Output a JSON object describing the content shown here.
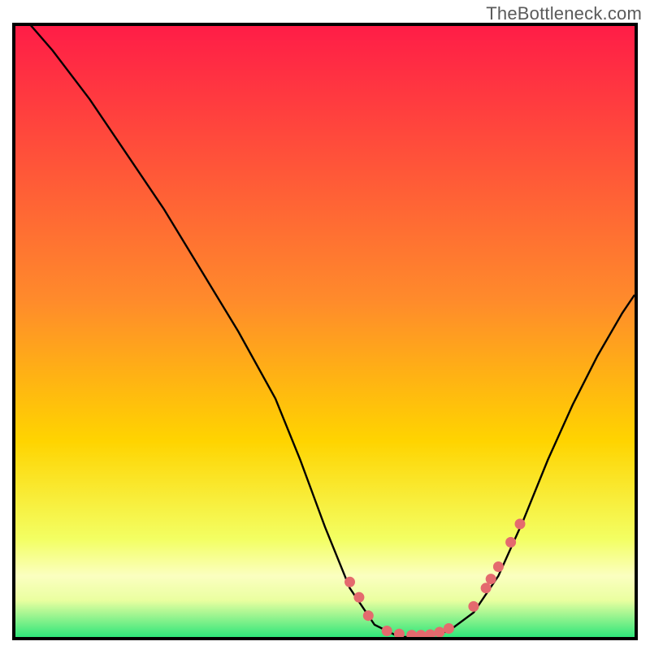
{
  "attribution": "TheBottleneck.com",
  "colors": {
    "gradient_top": "#ff1d47",
    "gradient_mid": "#ffd400",
    "gradient_low": "#f3ff63",
    "gradient_paleband": "#fbffc0",
    "gradient_bottom": "#2fe67a",
    "curve": "#000000",
    "points": "#e46a6e",
    "border": "#000000"
  },
  "chart_data": {
    "type": "line",
    "title": "",
    "xlabel": "",
    "ylabel": "",
    "xlim": [
      0,
      100
    ],
    "ylim": [
      0,
      100
    ],
    "grid": false,
    "legend": false,
    "series": [
      {
        "name": "bottleneck-curve",
        "x": [
          0,
          6,
          12,
          18,
          24,
          30,
          36,
          42,
          46,
          50,
          54,
          58,
          62,
          66,
          70,
          74,
          78,
          82,
          86,
          90,
          94,
          98,
          100
        ],
        "y": [
          103,
          96,
          88,
          79,
          70,
          60,
          50,
          39,
          29,
          18,
          8,
          2,
          0,
          0,
          1,
          4,
          10,
          19,
          29,
          38,
          46,
          53,
          56
        ]
      }
    ],
    "points": {
      "name": "highlighted-dots",
      "x": [
        54,
        55.5,
        57,
        60,
        62,
        64,
        65.5,
        67,
        68.5,
        70,
        74,
        76,
        76.8,
        78,
        80,
        81.5
      ],
      "y": [
        9,
        6.5,
        3.5,
        1,
        0.5,
        0.3,
        0.3,
        0.4,
        0.8,
        1.4,
        5,
        8,
        9.5,
        11.5,
        15.5,
        18.5
      ]
    }
  }
}
